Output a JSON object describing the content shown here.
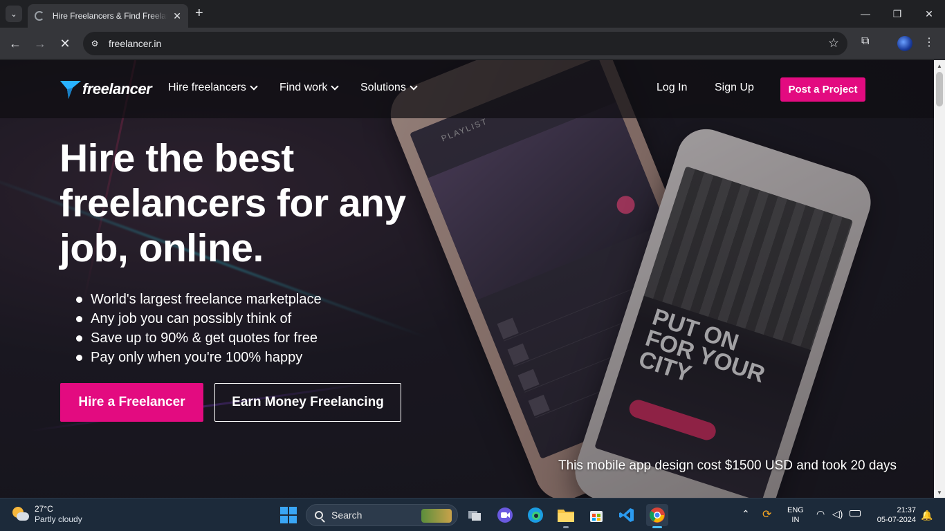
{
  "browser": {
    "tab_title": "Hire Freelancers & Find Freelance Jobs Online",
    "url": "freelancer.in",
    "new_tab_label": "+",
    "window_controls": {
      "minimize": "—",
      "maximize": "❐",
      "close": "✕"
    }
  },
  "site": {
    "logo_text": "freelancer",
    "nav": {
      "menus": [
        {
          "label": "Hire freelancers"
        },
        {
          "label": "Find work"
        },
        {
          "label": "Solutions"
        }
      ],
      "login": "Log In",
      "signup": "Sign Up",
      "post_project": "Post a Project"
    },
    "hero": {
      "title": "Hire the best freelancers for any job, online.",
      "bullets": [
        "World's largest freelance marketplace",
        "Any job you can possibly think of",
        "Save up to 90% & get quotes for free",
        "Pay only when you're 100% happy"
      ],
      "primary_button": "Hire a Freelancer",
      "secondary_button": "Earn Money Freelancing",
      "caption": "This mobile app design cost $1500 USD and took 20 days"
    },
    "phone_art": {
      "playlist_label": "PLAYLIST",
      "put_on_text": "PUT ON FOR YOUR CITY"
    }
  },
  "taskbar": {
    "weather": {
      "temp": "27°C",
      "condition": "Partly cloudy"
    },
    "search_placeholder": "Search",
    "language": {
      "line1": "ENG",
      "line2": "IN"
    },
    "clock": {
      "time": "21:37",
      "date": "05-07-2024"
    }
  },
  "colors": {
    "brand_pink": "#e30b80",
    "brand_blue": "#29b2fe",
    "chrome_dark": "#202124",
    "taskbar": "#1c2a3a"
  }
}
